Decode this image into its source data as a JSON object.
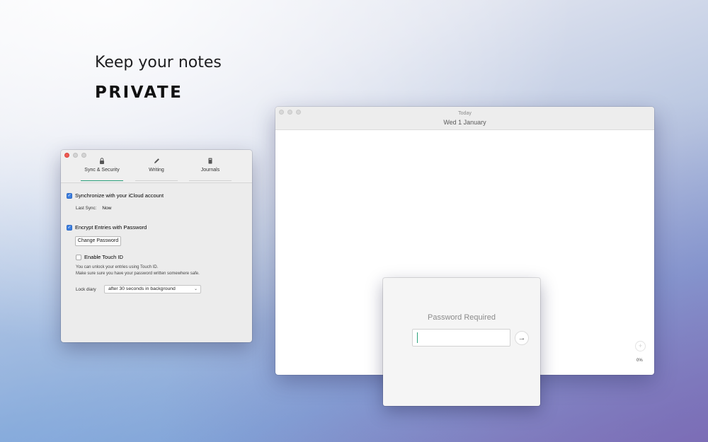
{
  "marketing": {
    "headline": "Keep your notes",
    "headline_strong": "PRIVATE"
  },
  "preferences": {
    "tabs": [
      {
        "label": "Sync & Security",
        "icon": "lock-icon"
      },
      {
        "label": "Writing",
        "icon": "pencil-icon"
      },
      {
        "label": "Journals",
        "icon": "book-icon"
      }
    ],
    "sync_label": "Synchronize with your iCloud account",
    "sync_checked": true,
    "last_sync_label": "Last Sync:",
    "last_sync_value": "Now",
    "encrypt_label": "Encrypt Entries with Password",
    "encrypt_checked": true,
    "change_password_label": "Change Password",
    "touch_id_label": "Enable Touch ID",
    "touch_id_checked": false,
    "help_line1": "You can unlock your entries using Touch ID.",
    "help_line2": "Make sure sure you have your password written somewhere safe.",
    "lock_diary_label": "Lock diary",
    "lock_diary_value": "after 30 seconds in background"
  },
  "journal": {
    "day_label": "Today",
    "date_label": "Wed 1 January",
    "add_symbol": "+",
    "progress_text": "0%"
  },
  "password_dialog": {
    "title": "Password Required",
    "input_value": "",
    "submit_symbol": "→"
  },
  "colors": {
    "accent": "#2b9f7a",
    "checkbox_blue": "#3d7fe0",
    "close_red": "#ee5b54"
  }
}
